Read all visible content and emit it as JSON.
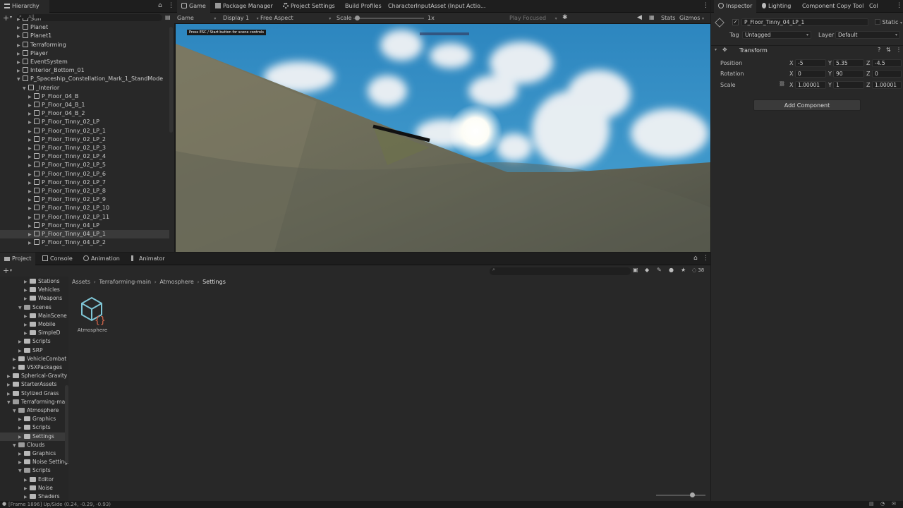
{
  "hierarchy": {
    "tab_label": "Hierarchy",
    "search_placeholder": "All",
    "rows": [
      {
        "label": "Sun",
        "indent": 2
      },
      {
        "label": "Planet",
        "indent": 2
      },
      {
        "label": "Planet1",
        "indent": 2
      },
      {
        "label": "Terraforming",
        "indent": 2
      },
      {
        "label": "Player",
        "indent": 2
      },
      {
        "label": "EventSystem",
        "indent": 2
      },
      {
        "label": "Interior_Bottom_01",
        "indent": 2
      },
      {
        "label": "P_Spaceship_Constellation_Mark_1_StandMode",
        "indent": 2
      },
      {
        "label": "_Interior",
        "indent": 3
      },
      {
        "label": "P_Floor_04_B",
        "indent": 4
      },
      {
        "label": "P_Floor_04_B_1",
        "indent": 4
      },
      {
        "label": "P_Floor_04_B_2",
        "indent": 4
      },
      {
        "label": "P_Floor_Tinny_02_LP",
        "indent": 4
      },
      {
        "label": "P_Floor_Tinny_02_LP_1",
        "indent": 4
      },
      {
        "label": "P_Floor_Tinny_02_LP_2",
        "indent": 4
      },
      {
        "label": "P_Floor_Tinny_02_LP_3",
        "indent": 4
      },
      {
        "label": "P_Floor_Tinny_02_LP_4",
        "indent": 4
      },
      {
        "label": "P_Floor_Tinny_02_LP_5",
        "indent": 4
      },
      {
        "label": "P_Floor_Tinny_02_LP_6",
        "indent": 4
      },
      {
        "label": "P_Floor_Tinny_02_LP_7",
        "indent": 4
      },
      {
        "label": "P_Floor_Tinny_02_LP_8",
        "indent": 4
      },
      {
        "label": "P_Floor_Tinny_02_LP_9",
        "indent": 4
      },
      {
        "label": "P_Floor_Tinny_02_LP_10",
        "indent": 4
      },
      {
        "label": "P_Floor_Tinny_02_LP_11",
        "indent": 4
      },
      {
        "label": "P_Floor_Tinny_04_LP",
        "indent": 4
      },
      {
        "label": "P_Floor_Tinny_04_LP_1",
        "indent": 4
      },
      {
        "label": "P_Floor_Tinny_04_LP_2",
        "indent": 4
      }
    ]
  },
  "center_tabs": [
    "Game",
    "Package Manager",
    "Project Settings",
    "Build Profiles",
    "CharacterInputAsset (Input Actio..."
  ],
  "game_toolbar": {
    "mode": "Game",
    "display": "Display 1",
    "aspect": "Free Aspect",
    "scale_label": "Scale",
    "scale_value": "1x",
    "play_focused": "Play Focused",
    "stats": "Stats",
    "gizmos": "Gizmos"
  },
  "game_view": {
    "hint": "Press ESC / Start button for scene controls"
  },
  "inspector": {
    "tabs": [
      "Inspector",
      "Lighting",
      "Component Copy Tool",
      "Col"
    ],
    "object_name": "P_Floor_Tinny_04_LP_1",
    "static_label": "Static",
    "tag_label": "Tag",
    "tag_value": "Untagged",
    "layer_label": "Layer",
    "layer_value": "Default",
    "transform_title": "Transform",
    "position_label": "Position",
    "rotation_label": "Rotation",
    "scale_label": "Scale",
    "position": {
      "x": "-5",
      "y": "5.35",
      "z": "-4.5"
    },
    "rotation": {
      "x": "0",
      "y": "90",
      "z": "0"
    },
    "scale": {
      "x": "1.00001",
      "y": "1",
      "z": "1.00001"
    },
    "add_component": "Add Component"
  },
  "bottom_tabs": [
    "Project",
    "Console",
    "Animation",
    "Animator"
  ],
  "project": {
    "breadcrumb": [
      "Assets",
      "Terraforming-main",
      "Atmosphere",
      "Settings"
    ],
    "hidden_count": "38",
    "asset_name": "Atmosphere",
    "tree": [
      {
        "label": "Stations",
        "indent": 4
      },
      {
        "label": "Vehicles",
        "indent": 4
      },
      {
        "label": "Weapons",
        "indent": 4
      },
      {
        "label": "Scenes",
        "indent": 3,
        "open": true
      },
      {
        "label": "MainScene",
        "indent": 4
      },
      {
        "label": "Mobile",
        "indent": 4
      },
      {
        "label": "SimpleD",
        "indent": 4
      },
      {
        "label": "Scripts",
        "indent": 3
      },
      {
        "label": "SRP",
        "indent": 3
      },
      {
        "label": "VehicleCombat",
        "indent": 2
      },
      {
        "label": "VSXPackages",
        "indent": 2
      },
      {
        "label": "Spherical-Gravity",
        "indent": 1
      },
      {
        "label": "StarterAssets",
        "indent": 1
      },
      {
        "label": "Stylized Grass",
        "indent": 1
      },
      {
        "label": "Terraforming-main",
        "indent": 1,
        "open": true
      },
      {
        "label": "Atmosphere",
        "indent": 2,
        "open": true
      },
      {
        "label": "Graphics",
        "indent": 3
      },
      {
        "label": "Scripts",
        "indent": 3
      },
      {
        "label": "Settings",
        "indent": 3,
        "selected": true
      },
      {
        "label": "Clouds",
        "indent": 2,
        "open": true
      },
      {
        "label": "Graphics",
        "indent": 3
      },
      {
        "label": "Noise Settings",
        "indent": 3
      },
      {
        "label": "Scripts",
        "indent": 3,
        "open": true
      },
      {
        "label": "Editor",
        "indent": 4
      },
      {
        "label": "Noise",
        "indent": 4
      },
      {
        "label": "Shaders",
        "indent": 4
      }
    ]
  },
  "status_bar": {
    "text": "[Frame 1896] Up/Side (0.24, -0.29, -0.93)"
  }
}
